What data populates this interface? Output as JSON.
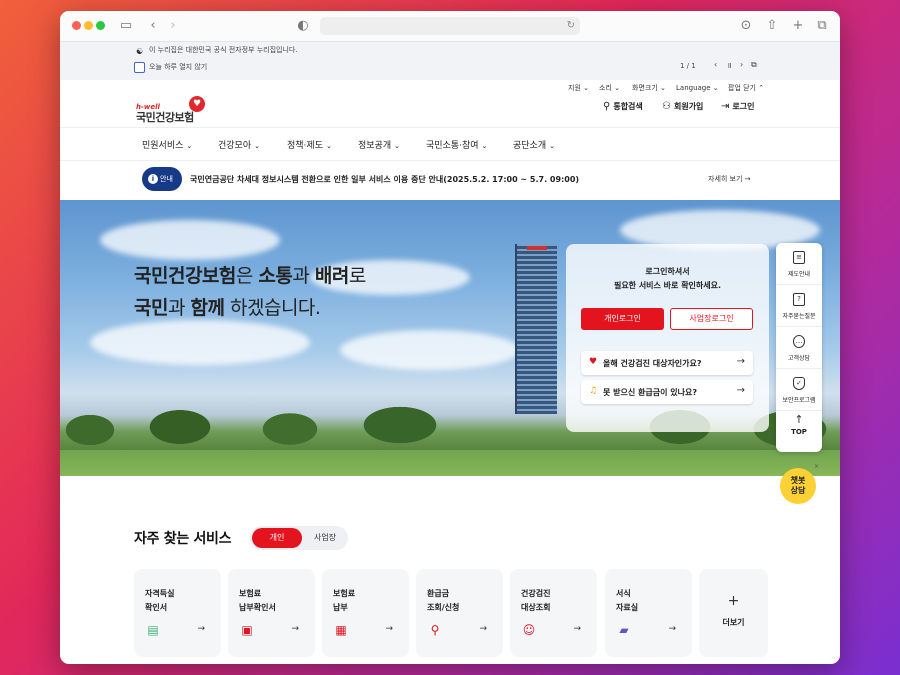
{
  "browser": {
    "reload_icon": "reload-icon"
  },
  "gov_banner": {
    "official_text": "이 누리집은 대한민국 공식 전자정부 누리집입니다.",
    "checkbox_label": "오늘 하루 열지 않기",
    "page_indicator": "1 / 1"
  },
  "utility": {
    "items": [
      "지원",
      "소리",
      "화면크기",
      "Language",
      "팝업 닫기"
    ]
  },
  "logo": {
    "tag": "h-well",
    "name": "국민건강보험"
  },
  "header_links": {
    "search": "통합검색",
    "signup": "회원가입",
    "login": "로그인"
  },
  "nav": {
    "items": [
      "민원서비스",
      "건강모아",
      "정책·제도",
      "정보공개",
      "국민소통·참여",
      "공단소개"
    ]
  },
  "notice": {
    "badge": "안내",
    "text": "국민연금공단 차세대 정보시스템 전환으로 인한 일부 서비스 이용 중단 안내(2025.5.2. 17:00 ~ 5.7. 09:00)",
    "more": "자세히 보기 →"
  },
  "hero": {
    "line1": [
      {
        "text": "국민건강보험",
        "bold": true
      },
      {
        "text": "은 ",
        "bold": false
      },
      {
        "text": "소통",
        "bold": true
      },
      {
        "text": "과 ",
        "bold": false
      },
      {
        "text": "배려",
        "bold": true
      },
      {
        "text": "로",
        "bold": false
      }
    ],
    "line2": [
      {
        "text": "국민",
        "bold": true
      },
      {
        "text": "과 ",
        "bold": false
      },
      {
        "text": "함께",
        "bold": true
      },
      {
        "text": " 하겠습니다.",
        "bold": false
      }
    ]
  },
  "login_card": {
    "message1": "로그인하셔서",
    "message2": "필요한 서비스 바로 확인하세요.",
    "personal_login": "개인로그인",
    "business_login": "사업장로그인",
    "checkup_question": "올해 건강검진 대상자인가요?",
    "refund_question": "못 받으신 환급금이 있나요?"
  },
  "side_menu": {
    "items": [
      "제도안내",
      "자주묻는질문",
      "고객상담",
      "보안프로그램"
    ],
    "top": "TOP"
  },
  "chatbot": {
    "line1": "챗봇",
    "line2": "상담"
  },
  "services": {
    "title": "자주 찾는 서비스",
    "toggle": {
      "personal": "개인",
      "business": "사업장"
    },
    "cards": [
      {
        "line1": "자격득실",
        "line2": "확인서",
        "icon": "document-check-icon"
      },
      {
        "line1": "보험료",
        "line2": "납부확인서",
        "icon": "payment-receipt-icon"
      },
      {
        "line1": "보험료",
        "line2": "납부",
        "icon": "payment-icon"
      },
      {
        "line1": "환급금",
        "line2": "조회/신청",
        "icon": "refund-search-icon"
      },
      {
        "line1": "건강검진",
        "line2": "대상조회",
        "icon": "checkup-user-icon"
      },
      {
        "line1": "서식",
        "line2": "자료실",
        "icon": "folder-download-icon"
      }
    ],
    "more": "더보기"
  }
}
